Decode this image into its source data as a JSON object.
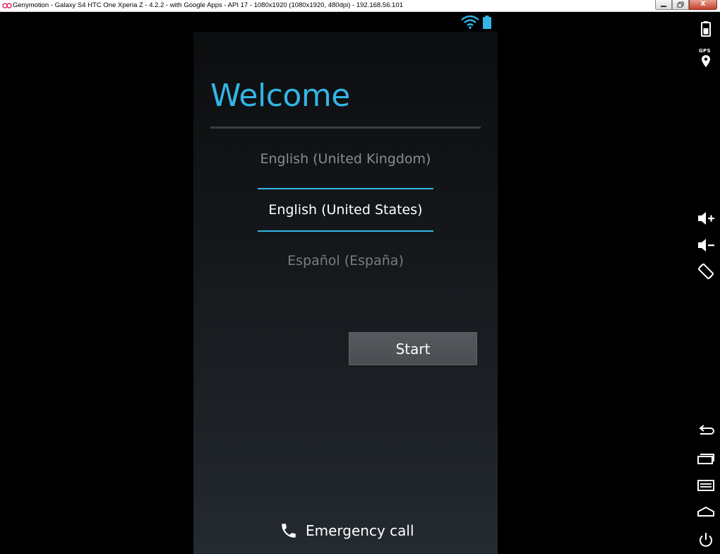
{
  "window": {
    "title": "Genymotion - Galaxy S4  HTC One  Xperia Z - 4.2.2 - with Google Apps - API 17 - 1080x1920 (1080x1920, 480dpi) - 192.168.56.101",
    "controls": {
      "minimize_icon": "minimize-icon",
      "restore_icon": "restore-icon",
      "close_icon": "close-icon",
      "close_glyph": "X"
    }
  },
  "status_bar": {
    "icons": [
      "wifi-icon",
      "battery-icon"
    ]
  },
  "setup": {
    "title": "Welcome",
    "languages": {
      "previous": "English (United Kingdom)",
      "selected": "English (United States)",
      "next": "Español (España)"
    },
    "start_label": "Start",
    "emergency_label": "Emergency call"
  },
  "toolbar": {
    "gps_label": "GPS",
    "icons": [
      "battery-icon",
      "gps-icon",
      "volume-up-icon",
      "volume-down-icon",
      "rotate-icon",
      "back-icon",
      "recent-apps-icon",
      "menu-icon",
      "home-icon",
      "power-icon"
    ]
  },
  "colors": {
    "accent": "#33b5e5",
    "titlebar": "#ffffff",
    "close_button": "#c6402b",
    "start_button": "#505458"
  }
}
